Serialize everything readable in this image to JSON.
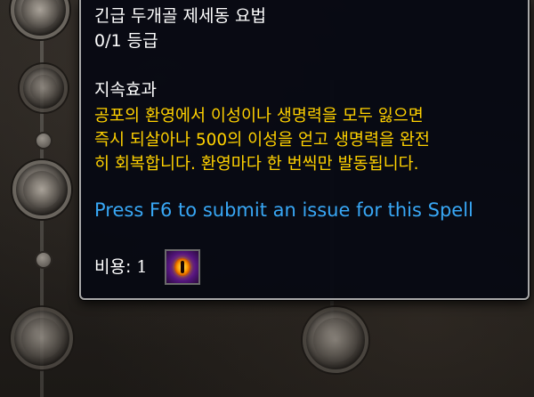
{
  "tooltip": {
    "title": "긴급 두개골 제세동 요법",
    "rank": "0/1 등급",
    "section_label": "지속효과",
    "description": "공포의 환영에서 이성이나 생명력을 모두 잃으면\n즉시 되살아나 500의 이성을 얻고 생명력을 완전\n히 회복합니다. 환영마다 한 번씩만 발동됩니다.",
    "report_link": "Press F6 to submit an issue for this Spell",
    "cost_label": "비용:",
    "cost_value": "1",
    "currency_icon": "eye-icon"
  },
  "colors": {
    "title": "#ffffff",
    "description": "#ffd100",
    "link": "#38a7f5",
    "tooltip_bg": "#060812",
    "tooltip_border": "#a8a8a8"
  }
}
